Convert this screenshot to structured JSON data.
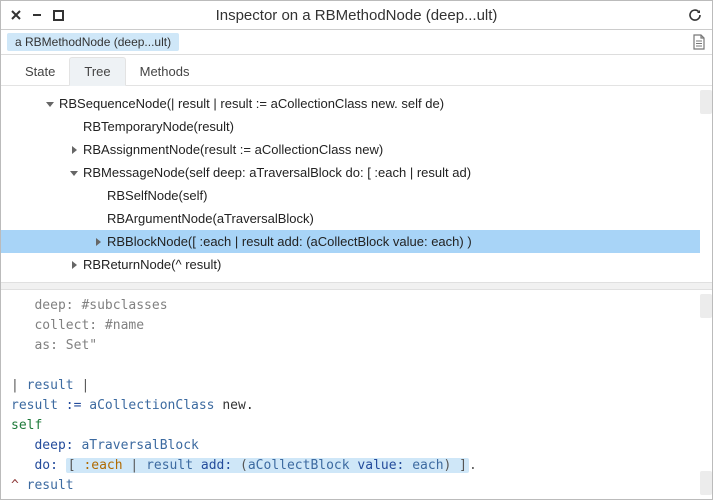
{
  "window": {
    "title": "Inspector on a RBMethodNode (deep...ult)"
  },
  "path": {
    "crumb": "a RBMethodNode (deep...ult)"
  },
  "tabs": [
    {
      "id": "state",
      "label": "State",
      "active": false
    },
    {
      "id": "tree",
      "label": "Tree",
      "active": true
    },
    {
      "id": "methods",
      "label": "Methods",
      "active": false
    }
  ],
  "tree": {
    "rows": [
      {
        "indent": 1,
        "expander": "open",
        "selected": false,
        "label": "RBSequenceNode(| result | result := aCollectionClass new. self de)"
      },
      {
        "indent": 2,
        "expander": "none",
        "selected": false,
        "label": "RBTemporaryNode(result)"
      },
      {
        "indent": 2,
        "expander": "closed",
        "selected": false,
        "label": "RBAssignmentNode(result := aCollectionClass new)"
      },
      {
        "indent": 2,
        "expander": "open",
        "selected": false,
        "label": "RBMessageNode(self deep: aTraversalBlock do: [ :each | result ad)"
      },
      {
        "indent": 3,
        "expander": "none",
        "selected": false,
        "label": "RBSelfNode(self)"
      },
      {
        "indent": 3,
        "expander": "none",
        "selected": false,
        "label": "RBArgumentNode(aTraversalBlock)"
      },
      {
        "indent": 3,
        "expander": "closed",
        "selected": true,
        "label": "RBBlockNode([ :each | result add: (aCollectBlock value: each) )"
      },
      {
        "indent": 2,
        "expander": "closed",
        "selected": false,
        "label": "RBReturnNode(^ result)"
      }
    ]
  },
  "code": {
    "l1": "   deep: #subclasses",
    "l2": "   collect: #name",
    "l3": "   as: Set\"",
    "l4": "",
    "l5": "| result |",
    "l6_a": "result",
    "l6_b": " := ",
    "l6_c": "aCollectionClass",
    "l6_d": " new.",
    "l7": "self",
    "l8_a": "   deep: ",
    "l8_b": "aTraversalBlock",
    "l9_a": "   do: ",
    "l9_b": "[ ",
    "l9_c": ":each",
    "l9_d": " | ",
    "l9_e": "result",
    "l9_f": " add: ",
    "l9_g": "(",
    "l9_h": "aCollectBlock",
    "l9_i": " value: ",
    "l9_j": "each",
    "l9_k": ")",
    "l9_l": " ]",
    "l9_m": ".",
    "l10_a": "^ ",
    "l10_b": "result"
  }
}
